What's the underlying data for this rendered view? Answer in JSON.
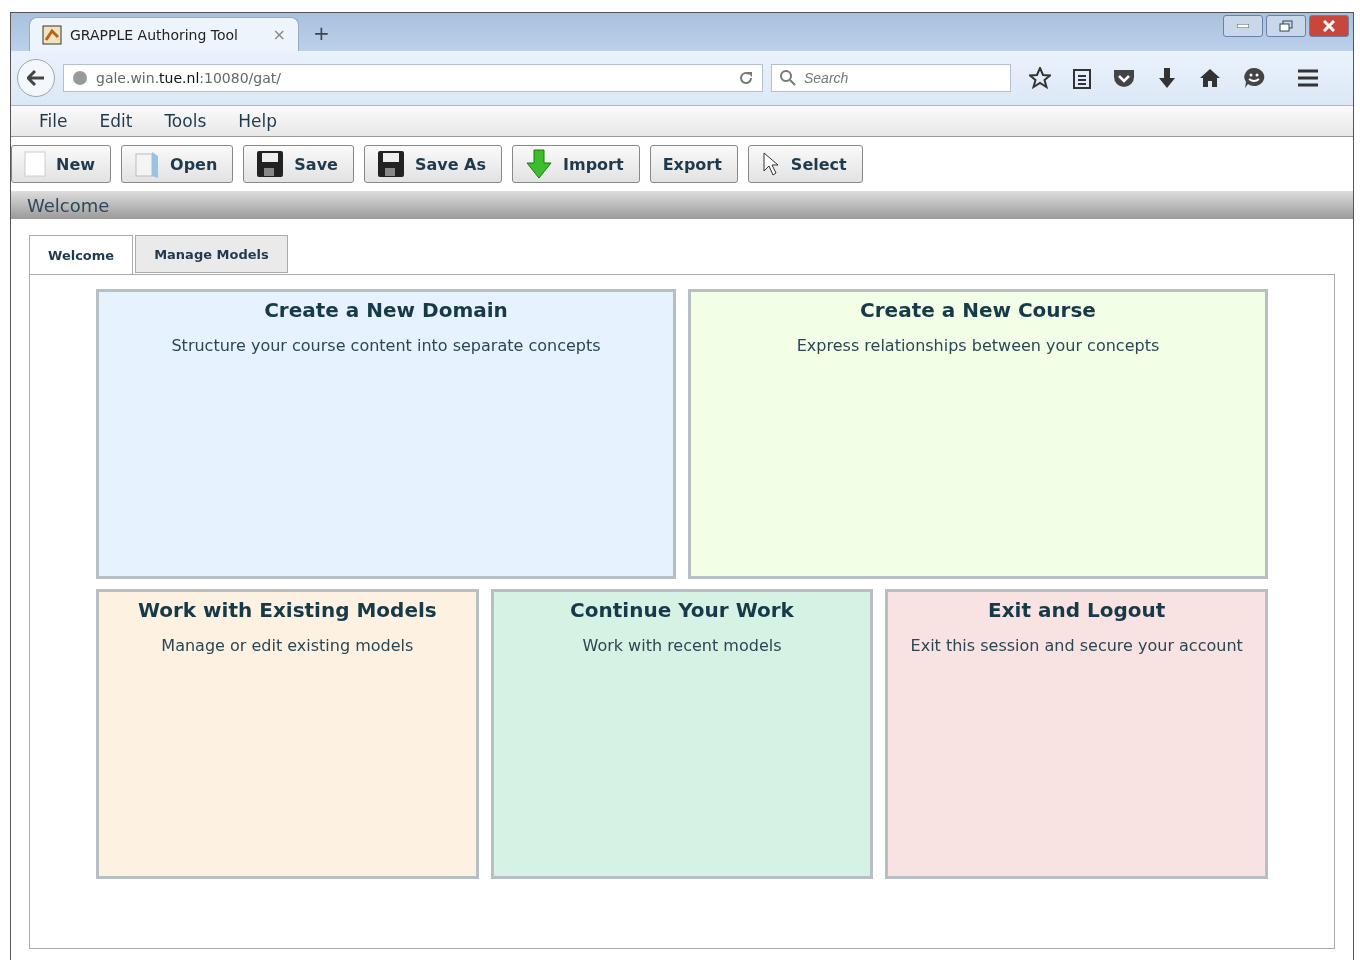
{
  "browser": {
    "tab_title": "GRAPPLE Authoring Tool",
    "tab_close": "×",
    "new_tab": "+",
    "url": "gale.win.**tue.nl**:10080/gat/",
    "search": {
      "placeholder": "Search"
    }
  },
  "menu": [
    "File",
    "Edit",
    "Tools",
    "Help"
  ],
  "toolbar": [
    {
      "label": "New",
      "kind": "page"
    },
    {
      "label": "Open",
      "kind": "folder"
    },
    {
      "label": "Save",
      "kind": "disk"
    },
    {
      "label": "Save As",
      "kind": "disk"
    },
    {
      "label": "Import",
      "kind": "import"
    },
    {
      "label": "Export",
      "kind": "plain"
    },
    {
      "label": "Select",
      "kind": "pointer"
    }
  ],
  "section_title": "Welcome",
  "tabs": [
    {
      "label": "Welcome",
      "selected": true
    },
    {
      "label": "Manage Models",
      "selected": false
    }
  ],
  "cards": [
    [
      {
        "title": "Create a New Domain",
        "text": "Structure your course content into separate concepts",
        "color": "#e6f2fe"
      },
      {
        "title": "Create a New Course",
        "text": "Express relationships between your concepts",
        "color": "#f2fee6"
      }
    ],
    [
      {
        "title": "Work with Existing Models",
        "text": "Manage or edit existing models",
        "color": "#fdf2e2"
      },
      {
        "title": "Continue Your Work",
        "text": "Work with recent models",
        "color": "#d6f2e4"
      },
      {
        "title": "Exit and Logout",
        "text": "Exit this session and secure your account",
        "color": "#f8e2e2"
      }
    ]
  ]
}
